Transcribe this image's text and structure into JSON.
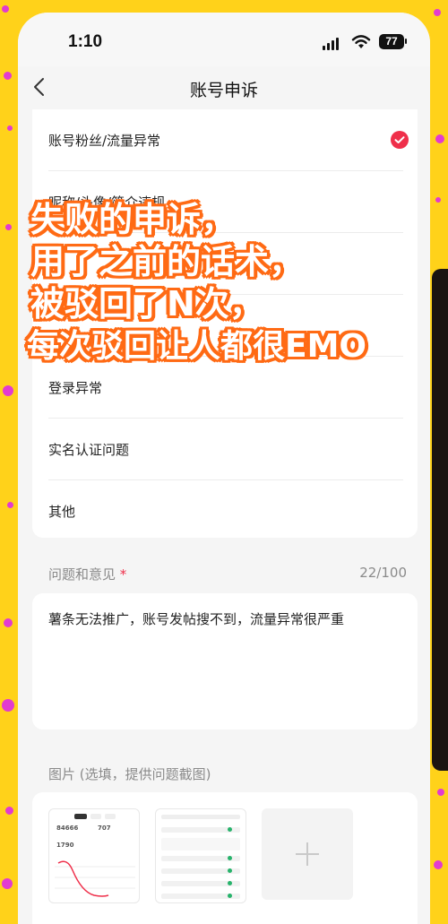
{
  "status_bar": {
    "time": "1:10",
    "battery": "77"
  },
  "nav": {
    "title": "账号申诉"
  },
  "options": [
    {
      "label": "账号粉丝/流量异常",
      "selected": true
    },
    {
      "label": "昵称/头像/简介违规",
      "selected": false
    },
    {
      "label": "",
      "selected": false
    },
    {
      "label": "",
      "selected": false
    },
    {
      "label": "登录异常",
      "selected": false
    },
    {
      "label": "实名认证问题",
      "selected": false
    },
    {
      "label": "其他",
      "selected": false
    }
  ],
  "feedback": {
    "label": "问题和意见",
    "required_mark": "*",
    "counter": "22/100",
    "text": "薯条无法推广，账号发帖搜不到，流量异常很严重"
  },
  "images": {
    "label": "图片 (选填，提供问题截图)",
    "thumb1": {
      "value_a": "84666",
      "value_b": "707",
      "value_c": "1790"
    },
    "add_icon": "plus-icon"
  },
  "overlay": {
    "lines": [
      "失败的申诉，",
      "用了之前的话术，",
      "被驳回了N次，",
      "每次驳回让人都很EMO"
    ]
  },
  "colors": {
    "accent": "#ef2f4a",
    "overlay_stroke": "#ff6a14",
    "frame": "#ffd21a"
  }
}
